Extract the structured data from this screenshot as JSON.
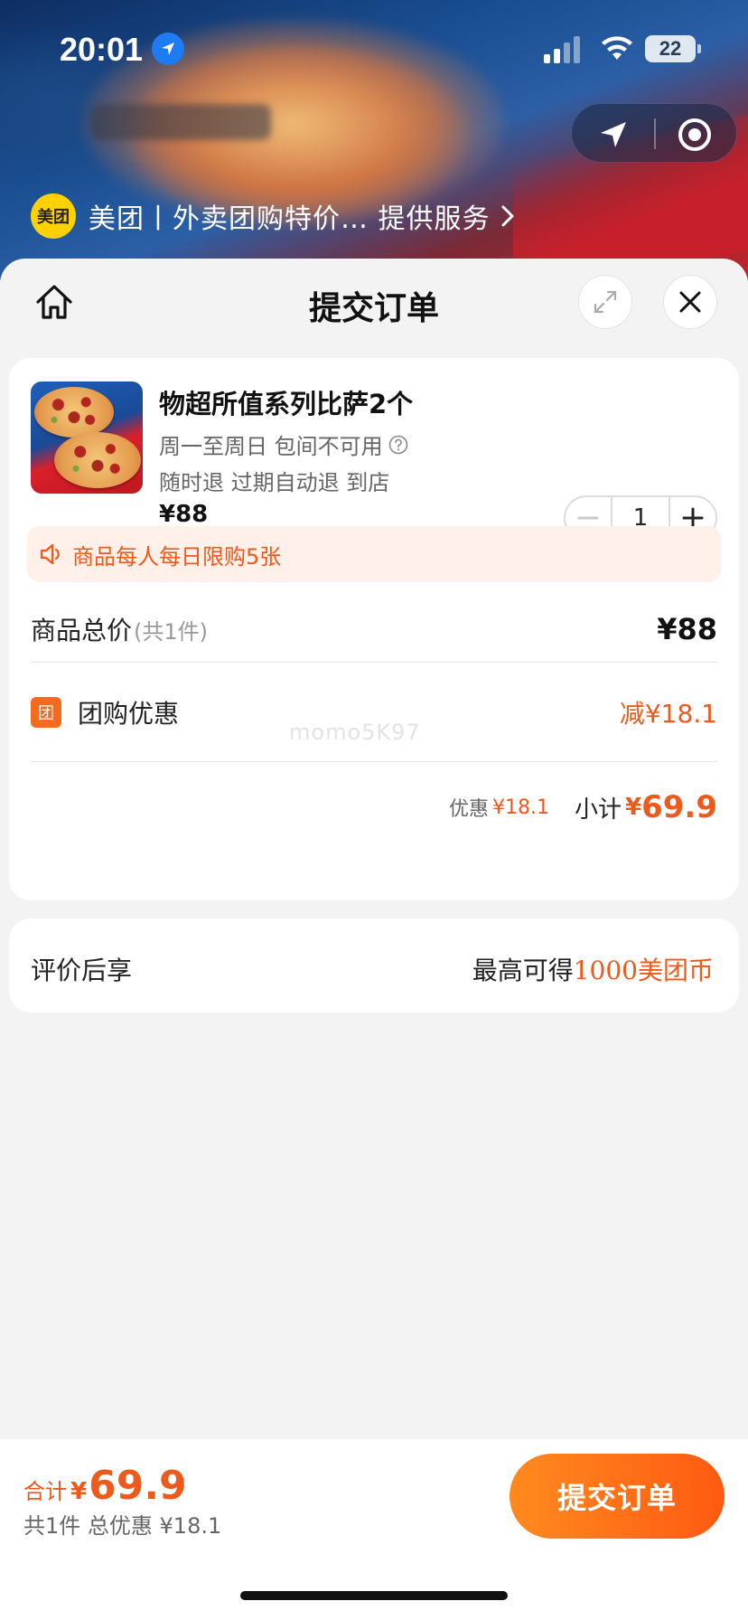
{
  "status_bar": {
    "time": "20:01",
    "battery": "22"
  },
  "provider": {
    "logo_text": "美团",
    "text": "美团丨外卖团购特价…  提供服务"
  },
  "sheet": {
    "title": "提交订单"
  },
  "product": {
    "name": "物超所值系列比萨2个",
    "line1": "周一至周日 包间不可用",
    "line2": "随时退 过期自动退 到店",
    "price": "¥88",
    "quantity": "1"
  },
  "notice": {
    "text": "商品每人每日限购5张"
  },
  "summary": {
    "total_label": "商品总价",
    "total_count": "(共1件)",
    "total_value": "¥88",
    "discount_tag": "团",
    "discount_label": "团购优惠",
    "discount_value": "减¥18.1",
    "watermark": "momo5K97",
    "saved_label": "优惠",
    "saved_value": "¥18.1",
    "subtotal_label": "小计",
    "subtotal_yen": "¥",
    "subtotal_value": "69.9"
  },
  "review": {
    "label": "评价后享",
    "right_prefix": "最高可得",
    "right_coins": "1000美团币"
  },
  "bottom": {
    "total_label": "合计",
    "total_yen": "¥",
    "total_value": "69.9",
    "sub_text": "共1件 总优惠 ¥18.1",
    "submit_label": "提交订单"
  },
  "colors": {
    "accent": "#ec5a1c",
    "button_start": "#ff8a1e",
    "button_end": "#ff5a12",
    "meituan_yellow": "#ffd100"
  },
  "icons": [
    "location-arrow-icon",
    "signal-icon",
    "wifi-icon",
    "battery-icon",
    "navigate-icon",
    "locate-icon",
    "chevron-right-icon",
    "home-icon",
    "expand-icon",
    "close-icon",
    "help-icon",
    "minus-icon",
    "plus-icon",
    "speaker-icon"
  ]
}
